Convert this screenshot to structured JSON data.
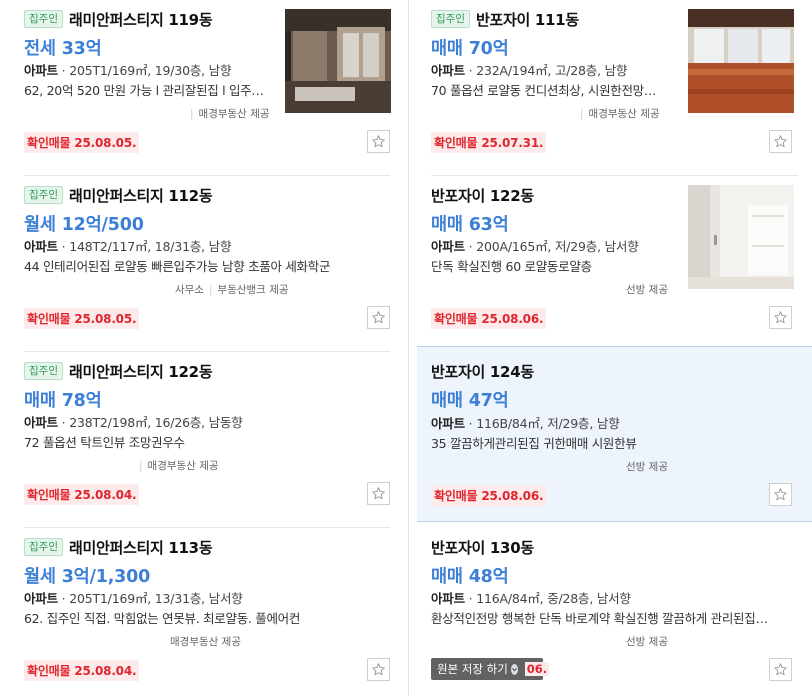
{
  "badge_label": "집주인",
  "confirm_label": "확인매물",
  "provided_suffix": "제공",
  "left": [
    {
      "owner": true,
      "name": "래미안퍼스티지 119동",
      "price": "전세 33억",
      "type": "아파트",
      "spec": "205T1/169㎡, 19/30층, 남향",
      "desc": "62, 20억 520 만원 가능 l 관리잘된집 l 입주…",
      "agent_prefix": "",
      "agent": "매경부동산",
      "date": "25.08.05.",
      "has_image": true
    },
    {
      "owner": true,
      "name": "래미안퍼스티지 112동",
      "price": "월세 12억/500",
      "type": "아파트",
      "spec": "148T2/117㎡, 18/31층, 남향",
      "desc": "44 인테리어된집 로얄동 빠른입주가능 남향 초품아 세화학군",
      "agent_prefix": "사무소",
      "agent": "부동산뱅크",
      "date": "25.08.05.",
      "has_image": false
    },
    {
      "owner": true,
      "name": "래미안퍼스티지 122동",
      "price": "매매 78억",
      "type": "아파트",
      "spec": "238T2/198㎡, 16/26층, 남동향",
      "desc": "72 풀옵션 탁트인뷰 조망권우수",
      "agent_prefix": "",
      "agent": "매경부동산",
      "date": "25.08.04.",
      "has_image": false
    },
    {
      "owner": true,
      "name": "래미안퍼스티지 113동",
      "price": "월세 3억/1,300",
      "type": "아파트",
      "spec": "205T1/169㎡, 13/31층, 남서향",
      "desc": "62. 집주인 직접. 막힘없는 연못뷰. 최로얄동. 풀에어컨",
      "agent_prefix": "",
      "agent": "매경부동산",
      "date": "25.08.04.",
      "has_image": false
    }
  ],
  "right": [
    {
      "owner": true,
      "name": "반포자이 111동",
      "price": "매매 70억",
      "type": "아파트",
      "spec": "232A/194㎡, 고/28층, 남향",
      "desc": "70 풀옵션 로얄동 컨디션최상, 시원한전망…",
      "agent": "매경부동산",
      "date": "25.07.31.",
      "has_image": true
    },
    {
      "owner": false,
      "name": "반포자이 122동",
      "price": "매매 63억",
      "type": "아파트",
      "spec": "200A/165㎡, 저/29층, 남서향",
      "desc": "단독 확실진행 60 로얄동로얄층",
      "agent": "선방",
      "date": "25.08.06.",
      "has_image": true
    },
    {
      "owner": false,
      "name": "반포자이 124동",
      "price": "매매 47억",
      "type": "아파트",
      "spec": "116B/84㎡, 저/29층, 남향",
      "desc": "35 깔끔하게관리된집 귀한매매 시원한뷰",
      "agent": "선방",
      "date": "25.08.06.",
      "has_image": false,
      "highlight": true
    },
    {
      "owner": false,
      "name": "반포자이 130동",
      "price": "매매 48억",
      "type": "아파트",
      "spec": "116A/84㎡, 중/28층, 남서향",
      "desc": "환상적인전망 행복한 단독 바로계약 확실진행 깔끔하게 관리된집…",
      "agent": "선방",
      "date": "25.08.06.",
      "has_image": false
    }
  ],
  "toast": {
    "label": "원본 저장 하기",
    "tail": "06."
  }
}
